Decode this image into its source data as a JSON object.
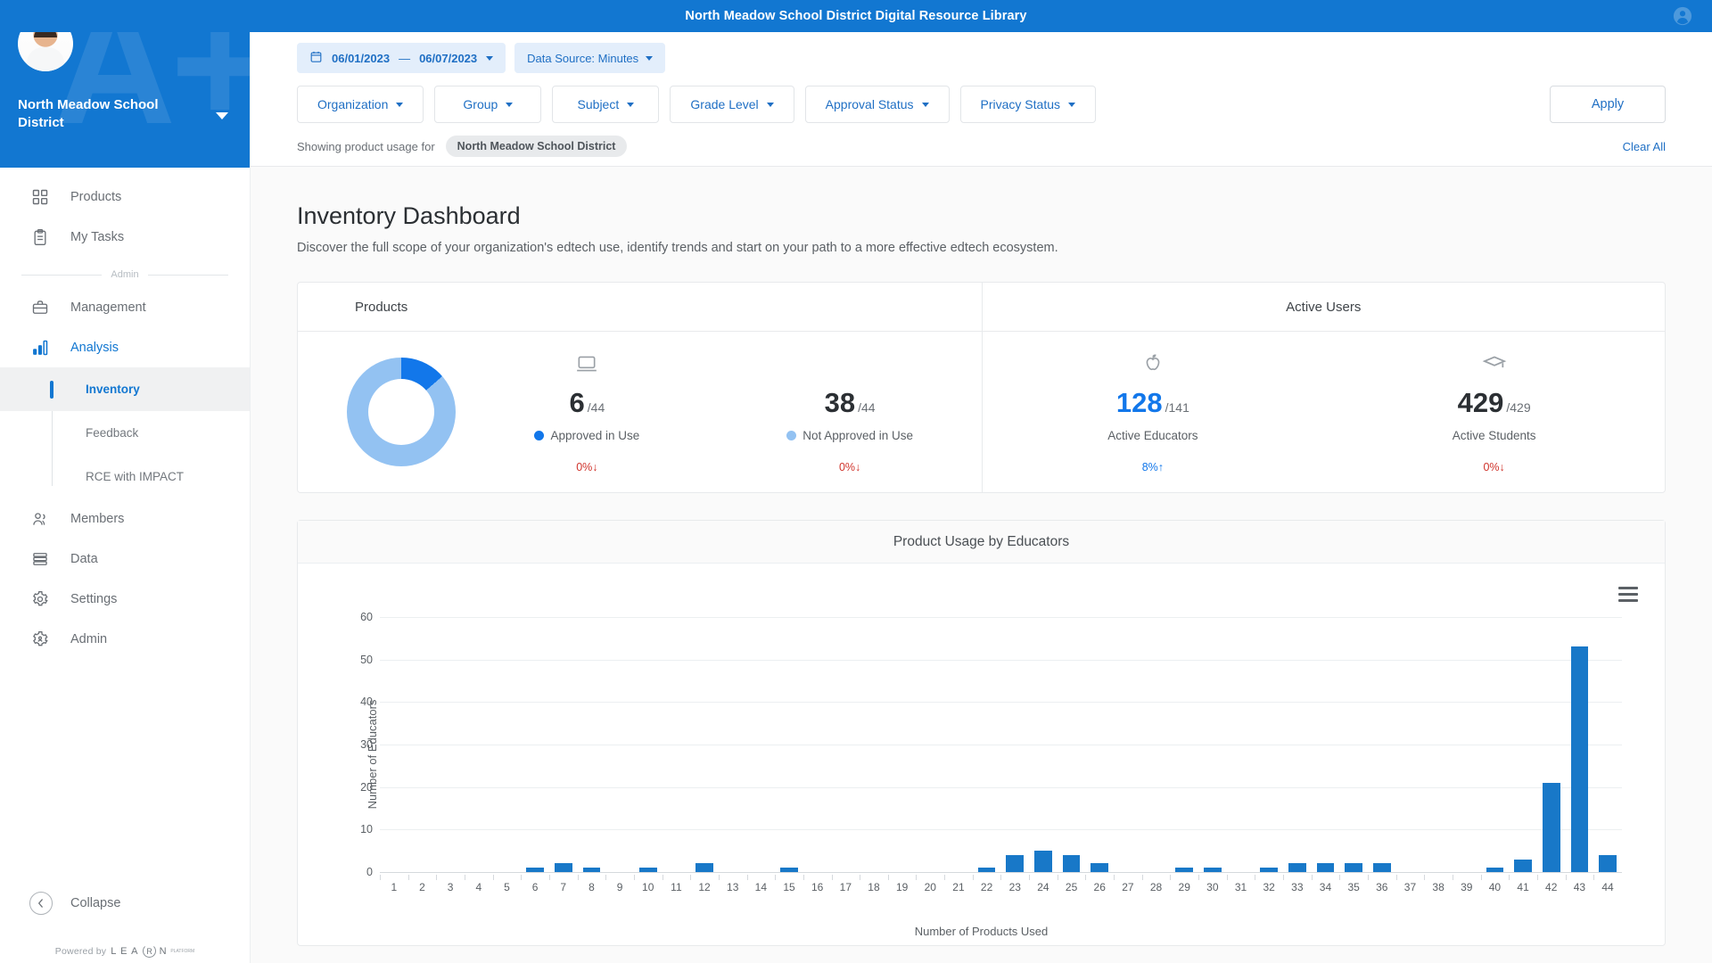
{
  "topbar": {
    "title": "North Meadow School District Digital Resource Library",
    "account_icon": "account-circle-icon"
  },
  "sidebar": {
    "org_name": "North Meadow School District",
    "watermark": "A+",
    "primary_items": [
      {
        "label": "Products",
        "icon": "grid-apps-icon"
      },
      {
        "label": "My Tasks",
        "icon": "clipboard-icon"
      }
    ],
    "section_label": "Admin",
    "admin_items": [
      {
        "label": "Management",
        "icon": "briefcase-icon"
      },
      {
        "label": "Analysis",
        "icon": "bar-chart-icon",
        "active": true
      },
      {
        "label": "Members",
        "icon": "people-icon"
      },
      {
        "label": "Data",
        "icon": "database-icon"
      },
      {
        "label": "Settings",
        "icon": "gear-icon"
      },
      {
        "label": "Admin",
        "icon": "gear-person-icon"
      }
    ],
    "sub_items": [
      {
        "label": "Inventory",
        "active": true
      },
      {
        "label": "Feedback",
        "active": false
      },
      {
        "label": "RCE with IMPACT",
        "active": false
      }
    ],
    "collapse_label": "Collapse",
    "powered_by": "Powered by",
    "brand": {
      "l": "L",
      "e": "E",
      "a": "A",
      "r": "R",
      "n": "N",
      "tm": "PLATFORM"
    }
  },
  "filters": {
    "date_start": "06/01/2023",
    "date_separator": "—",
    "date_end": "06/07/2023",
    "data_source": "Data Source: Minutes",
    "buttons": [
      "Organization",
      "Group",
      "Subject",
      "Grade Level",
      "Approval Status",
      "Privacy Status"
    ],
    "apply_label": "Apply",
    "showing_text": "Showing product usage for",
    "showing_chip": "North Meadow School District",
    "clear_all": "Clear All"
  },
  "page": {
    "title": "Inventory Dashboard",
    "subtitle": "Discover the full scope of your organization's edtech use, identify trends and start on your path to a more effective edtech ecosystem."
  },
  "summary": {
    "products": {
      "header": "Products",
      "donut": {
        "approved_deg": 49,
        "approved_color": "#1277ea",
        "not_approved_color": "#93c2f2"
      },
      "metrics": [
        {
          "icon": "laptop-icon",
          "value": "6",
          "denominator": "/44",
          "label": "Approved in Use",
          "dot_color": "#1277ea",
          "delta": "0%",
          "delta_arrow": "↓",
          "delta_dir": "down"
        },
        {
          "icon": "none",
          "value": "38",
          "denominator": "/44",
          "label": "Not Approved in Use",
          "dot_color": "#93c2f2",
          "delta": "0%",
          "delta_arrow": "↓",
          "delta_dir": "down"
        }
      ]
    },
    "active_users": {
      "header": "Active Users",
      "metrics": [
        {
          "icon": "apple-icon",
          "value": "128",
          "denominator": "/141",
          "label": "Active Educators",
          "value_color": "#1277ea",
          "delta": "8%",
          "delta_arrow": "↑",
          "delta_dir": "up"
        },
        {
          "icon": "graduation-cap-icon",
          "value": "429",
          "denominator": "/429",
          "label": "Active Students",
          "value_color": "#2b2f33",
          "delta": "0%",
          "delta_arrow": "↓",
          "delta_dir": "down"
        }
      ]
    }
  },
  "chart_data": {
    "type": "bar",
    "title": "Product Usage by Educators",
    "xlabel": "Number of Products Used",
    "ylabel": "Number of Educators",
    "ylim": [
      0,
      65
    ],
    "yticks": [
      0,
      10,
      20,
      30,
      40,
      50,
      60
    ],
    "grid": true,
    "legend": false,
    "bar_color": "#1878c8",
    "categories": [
      1,
      2,
      3,
      4,
      5,
      6,
      7,
      8,
      9,
      10,
      11,
      12,
      13,
      14,
      15,
      16,
      17,
      18,
      19,
      20,
      21,
      22,
      23,
      24,
      25,
      26,
      27,
      28,
      29,
      30,
      31,
      32,
      33,
      34,
      35,
      36,
      37,
      38,
      39,
      40,
      41,
      42,
      43,
      44
    ],
    "values": [
      0,
      0,
      0,
      0,
      0,
      1,
      2,
      1,
      0,
      1,
      0,
      2,
      0,
      0,
      1,
      0,
      0,
      0,
      0,
      0,
      0,
      1,
      4,
      5,
      4,
      2,
      0,
      0,
      1,
      1,
      0,
      1,
      2,
      2,
      2,
      2,
      0,
      0,
      0,
      1,
      3,
      21,
      53,
      4
    ],
    "menu_icon": "hamburger-menu-icon"
  }
}
